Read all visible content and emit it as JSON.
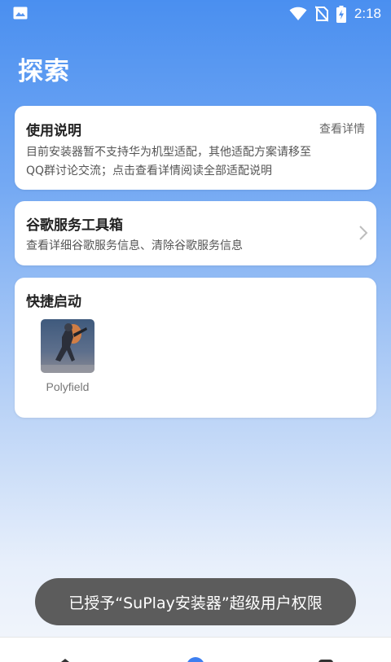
{
  "status_bar": {
    "time": "2:18",
    "icons": [
      "image-icon",
      "wifi-icon",
      "no-sim-icon",
      "battery-charging-icon"
    ]
  },
  "page": {
    "title": "探索"
  },
  "cards": {
    "usage": {
      "title": "使用说明",
      "link": "查看详情",
      "description_line1": "目前安装器暂不支持华为机型适配，其他适配方案请移至",
      "description_line2": "QQ群讨论交流；点击查看详情阅读全部适配说明"
    },
    "google_tools": {
      "title": "谷歌服务工具箱",
      "description": "查看详细谷歌服务信息、清除谷歌服务信息",
      "icon": "chevron-right-icon"
    },
    "quick_launch": {
      "title": "快捷启动",
      "apps": [
        {
          "name": "Polyfield",
          "icon": "polyfield-app-icon"
        }
      ]
    }
  },
  "toast": {
    "message": "已授予“SuPlay安装器”超级用户权限"
  },
  "bottom_nav": {
    "items": [
      "home-icon",
      "discover-icon",
      "profile-icon"
    ],
    "active_color": "#3d7ff0"
  },
  "colors": {
    "accent": "#4a8ff0",
    "card": "#ffffff",
    "toast": "#5c5c5c"
  }
}
